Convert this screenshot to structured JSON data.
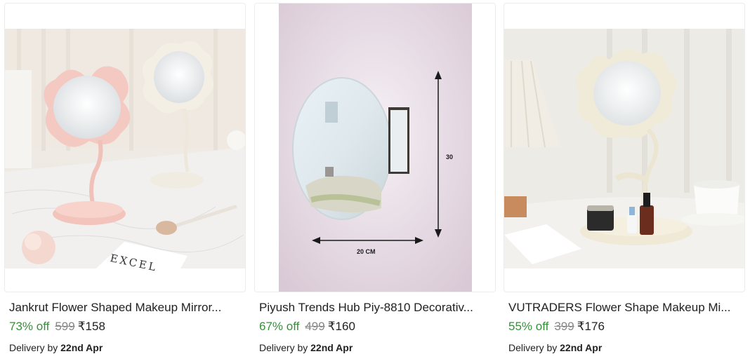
{
  "products": [
    {
      "title": "Jankrut Flower Shaped Makeup Mirror...",
      "discount": "73% off",
      "mrp": "599",
      "price": "₹158",
      "delivery_prefix": "Delivery by",
      "delivery_date": "22nd Apr",
      "image_text": "EXCEL"
    },
    {
      "title": "Piyush Trends Hub Piy-8810 Decorativ...",
      "discount": "67% off",
      "mrp": "499",
      "price": "₹160",
      "delivery_prefix": "Delivery by",
      "delivery_date": "22nd Apr",
      "dim_height": "30",
      "dim_width": "20 CM"
    },
    {
      "title": "VUTRADERS Flower Shape Makeup Mi...",
      "discount": "55% off",
      "mrp": "399",
      "price": "₹176",
      "delivery_prefix": "Delivery by",
      "delivery_date": "22nd Apr"
    }
  ],
  "colors": {
    "discount": "#388e3c",
    "mrp": "#878787",
    "text": "#212121"
  }
}
